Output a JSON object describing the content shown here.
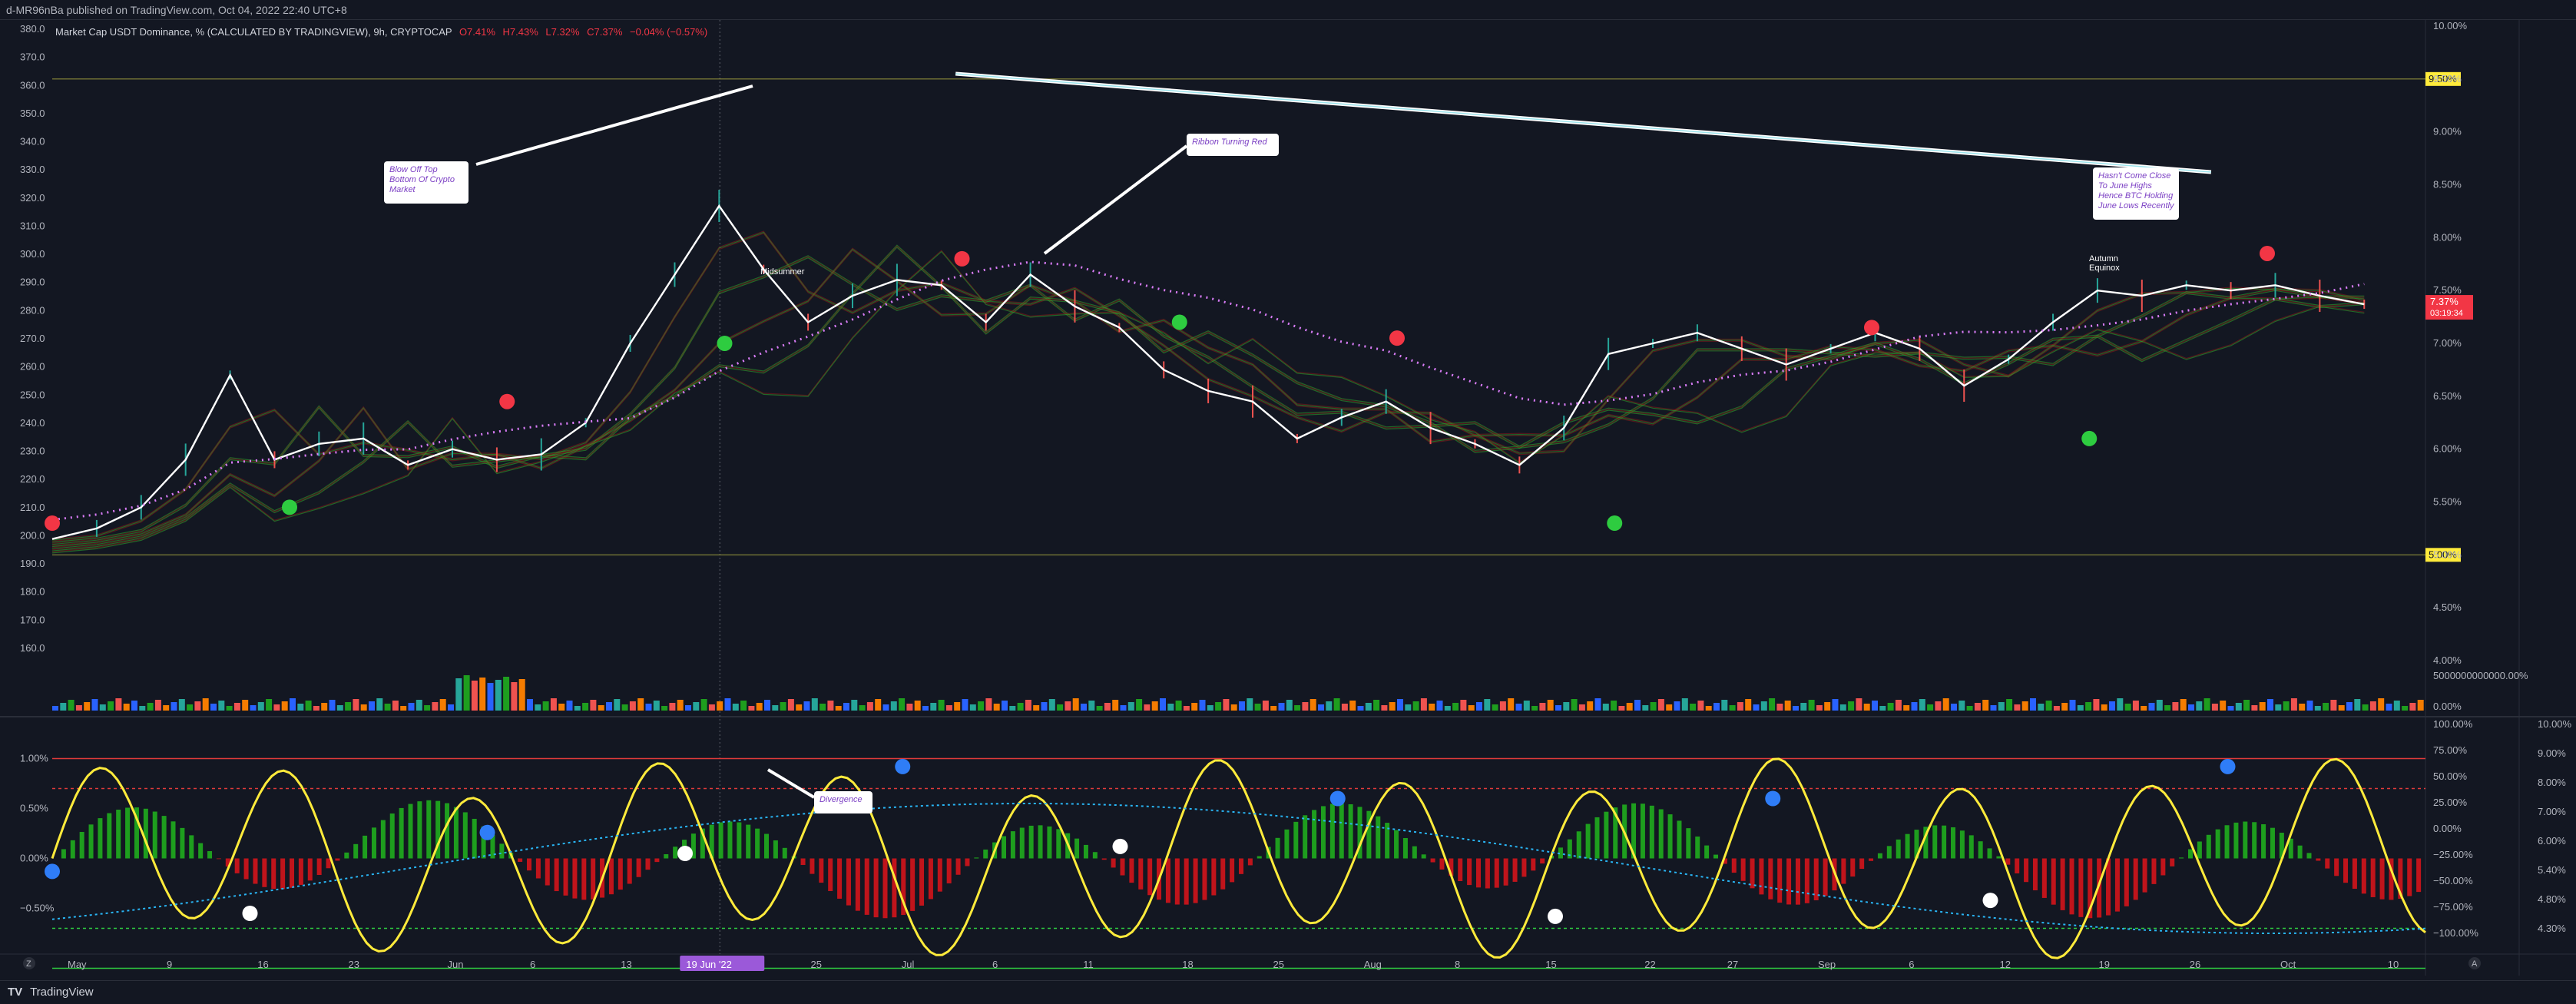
{
  "header": {
    "attribution": "d-MR96nBa published on TradingView.com, Oct 04, 2022 22:40 UTC+8"
  },
  "legend": {
    "title": "Market Cap USDT Dominance, % (CALCULATED BY TRADINGVIEW), 9h, CRYPTOCAP",
    "o": "O7.41%",
    "h": "H7.43%",
    "l": "L7.32%",
    "c": "C7.37%",
    "chg": "−0.04% (−0.57%)"
  },
  "footer": {
    "brand": "TradingView",
    "panel_button_z": "Z",
    "panel_button_a": "A"
  },
  "colors": {
    "background": "#131722",
    "bull": "#26a69a",
    "bear": "#ef5350",
    "price_line": "#ffffff",
    "osc_line": "#ffeb3b",
    "osc_hist_pos": "#1e9e1e",
    "osc_hist_neg": "#c0141b",
    "dots_ema": "#d97cf7",
    "osc_signal": "#29b6f6",
    "trend_line": "#9be3ec",
    "price_tag_bg": "#f23645",
    "level_tag_bg": "#ffeb3b"
  },
  "chart_data": [
    {
      "type": "line",
      "name": "main-price",
      "y_left_ticks": [
        "380.0",
        "370.0",
        "360.0",
        "350.0",
        "340.0",
        "330.0",
        "320.0",
        "310.0",
        "300.0",
        "290.0",
        "280.0",
        "270.0",
        "260.0",
        "250.0",
        "240.0",
        "230.0",
        "220.0",
        "210.0",
        "200.0",
        "190.0",
        "180.0",
        "170.0",
        "160.0"
      ],
      "y_right_ticks": [
        "10.00%",
        "9.50%",
        "9.00%",
        "8.50%",
        "8.00%",
        "7.50%",
        "7.00%",
        "6.50%",
        "6.00%",
        "5.50%",
        "5.00%",
        "4.50%",
        "4.00%"
      ],
      "ylim_pct": [
        4.0,
        10.0
      ],
      "x_ticks": [
        "May",
        "9",
        "16",
        "23",
        "Jun",
        "6",
        "13",
        "19 Jun '22",
        "25",
        "Jul",
        "6",
        "11",
        "18",
        "25",
        "Aug",
        "8",
        "15",
        "22",
        "27",
        "Sep",
        "6",
        "12",
        "19",
        "26",
        "Oct",
        "10"
      ],
      "x": [
        0,
        7,
        14,
        21,
        28,
        35,
        42,
        49,
        56,
        63,
        70,
        77,
        84,
        91,
        98,
        105,
        112,
        119,
        126,
        133,
        140,
        147,
        154
      ],
      "values_pct": [
        5.15,
        5.25,
        5.45,
        5.9,
        6.7,
        5.9,
        6.05,
        6.1,
        5.85,
        6.0,
        5.9,
        5.95,
        6.25,
        7.0,
        7.65,
        8.3,
        7.7,
        7.2,
        7.45,
        7.6,
        7.55,
        7.2,
        7.65,
        7.35,
        7.15,
        6.75,
        6.55,
        6.45,
        6.1,
        6.3,
        6.45,
        6.2,
        6.05,
        5.85,
        6.2,
        6.9,
        7.0,
        7.1,
        6.95,
        6.8,
        6.95,
        7.1,
        6.95,
        6.6,
        6.85,
        7.2,
        7.5,
        7.45,
        7.55,
        7.5,
        7.55,
        7.45,
        7.37
      ],
      "horizontal_levels": [
        {
          "label": "9.50%",
          "value": 9.5
        },
        {
          "label": "5.00%",
          "value": 5.0
        }
      ],
      "last_price": {
        "label": "7.37%",
        "countdown": "03:19:34"
      },
      "annotations": [
        {
          "text": "Blow Off Top Bottom Of Crypto Market"
        },
        {
          "text": "Ribbon Turning Red"
        },
        {
          "text": "Hasn't Come Close To June Highs Hence BTC Holding June Lows Recently"
        },
        {
          "text": "Midsummer"
        },
        {
          "text": "Autumn Equinox"
        }
      ],
      "signal_dots": {
        "red": [
          {
            "x": 0,
            "y": 5.3
          },
          {
            "x": 23,
            "y": 6.45
          },
          {
            "x": 46,
            "y": 7.8
          },
          {
            "x": 68,
            "y": 7.05
          },
          {
            "x": 92,
            "y": 7.15
          },
          {
            "x": 112,
            "y": 7.85
          }
        ],
        "green": [
          {
            "x": 12,
            "y": 5.45
          },
          {
            "x": 34,
            "y": 7.0
          },
          {
            "x": 57,
            "y": 7.2
          },
          {
            "x": 79,
            "y": 5.3
          },
          {
            "x": 103,
            "y": 6.1
          }
        ]
      }
    },
    {
      "type": "bar",
      "name": "volume",
      "y_right_ticks": [
        "5000000000000.00%",
        "0.00%"
      ]
    },
    {
      "type": "line",
      "name": "oscillator",
      "y_left_ticks": [
        "1.00%",
        "0.50%",
        "0.00%",
        "−0.50%"
      ],
      "y_right_ticks_a": [
        "100.00%",
        "75.00%",
        "50.00%",
        "25.00%",
        "0.00%",
        "−25.00%",
        "−50.00%",
        "−75.00%",
        "−100.00%"
      ],
      "y_right_ticks_b": [
        "10.00%",
        "9.00%",
        "8.00%",
        "7.00%",
        "6.00%",
        "5.40%",
        "4.80%",
        "4.30%"
      ],
      "annotations": [
        {
          "text": "Divergence"
        }
      ],
      "signal_dots": {
        "blue": [
          {
            "x": 0,
            "y": -0.13
          },
          {
            "x": 22,
            "y": 0.26
          },
          {
            "x": 43,
            "y": 0.92
          },
          {
            "x": 65,
            "y": 0.6
          },
          {
            "x": 87,
            "y": 0.6
          },
          {
            "x": 110,
            "y": 0.92
          }
        ],
        "white": [
          {
            "x": 10,
            "y": -0.55
          },
          {
            "x": 32,
            "y": 0.05
          },
          {
            "x": 54,
            "y": 0.12
          },
          {
            "x": 76,
            "y": -0.58
          },
          {
            "x": 98,
            "y": -0.42
          }
        ]
      }
    }
  ]
}
